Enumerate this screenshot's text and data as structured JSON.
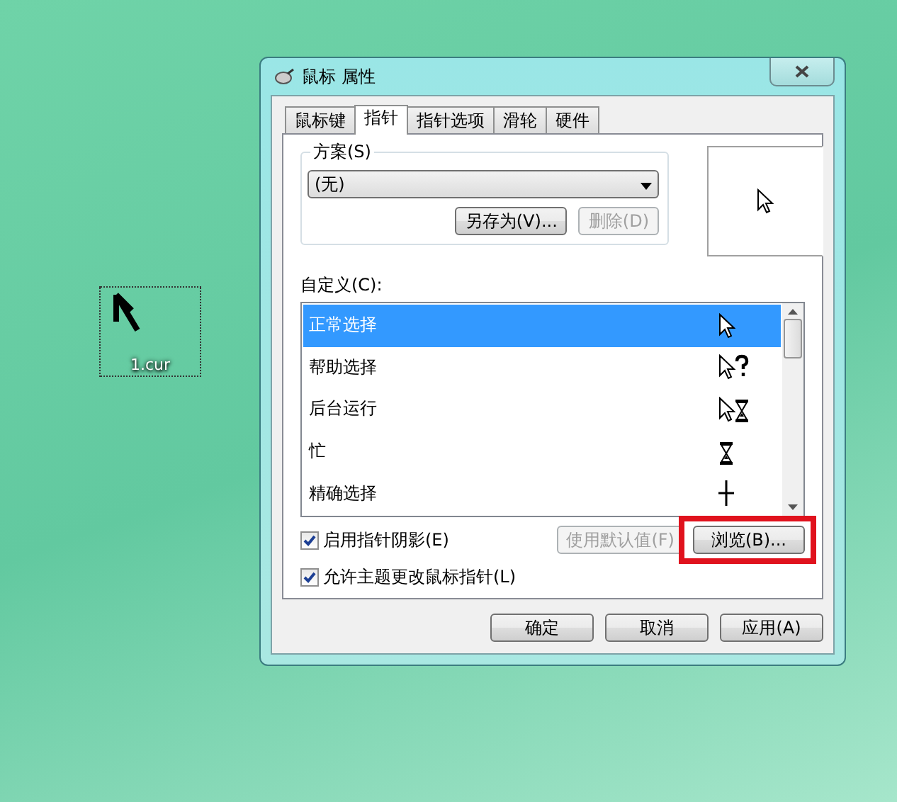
{
  "desktop_icon": {
    "label": "1.cur",
    "selected": true
  },
  "window": {
    "title": "鼠标 属性"
  },
  "tabs": [
    {
      "label": "鼠标键",
      "selected": false
    },
    {
      "label": "指针",
      "selected": true
    },
    {
      "label": "指针选项",
      "selected": false
    },
    {
      "label": "滑轮",
      "selected": false
    },
    {
      "label": "硬件",
      "selected": false
    }
  ],
  "scheme": {
    "group_label": "方案(S)",
    "dropdown_value": "(无)",
    "buttons": [
      {
        "label": "另存为(V)...",
        "disabled": false
      },
      {
        "label": "删除(D)",
        "disabled": true
      }
    ]
  },
  "customize": {
    "label": "自定义(C):",
    "rows": [
      {
        "name": "正常选择",
        "kind": "arrow",
        "selected": true
      },
      {
        "name": "帮助选择",
        "kind": "help",
        "selected": false
      },
      {
        "name": "后台运行",
        "kind": "working",
        "selected": false
      },
      {
        "name": "忙",
        "kind": "busy",
        "selected": false
      },
      {
        "name": "精确选择",
        "kind": "precision",
        "selected": false
      }
    ]
  },
  "pointer_shadow": {
    "label": "启用指针阴影(E)",
    "checked": true
  },
  "default_button": {
    "label": "使用默认值(F)",
    "disabled": true
  },
  "browse_button": {
    "label": "浏览(B)...",
    "highlighted": true
  },
  "theme_checkbox": {
    "label": "允许主题更改鼠标指针(L)",
    "checked": true
  },
  "buttons": [
    "确定",
    "取消",
    "应用(A)"
  ]
}
